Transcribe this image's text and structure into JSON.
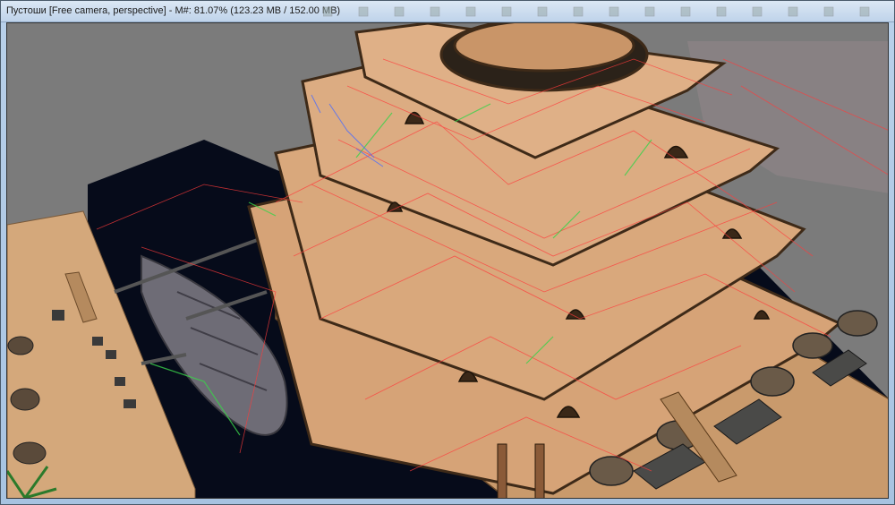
{
  "window": {
    "title": "Пустоши [Free camera, perspective] - M#: 81.07% (123.23 MB / 152.00 MB)"
  },
  "viewport": {
    "scene": "3d-level-editor-view",
    "background_color": "#7b7b7b",
    "water_color": "#060b1a",
    "sand_color": "#d3a67a",
    "wireframe_colors": [
      "#ff3b3b",
      "#39d24a",
      "#4a6cff"
    ]
  }
}
